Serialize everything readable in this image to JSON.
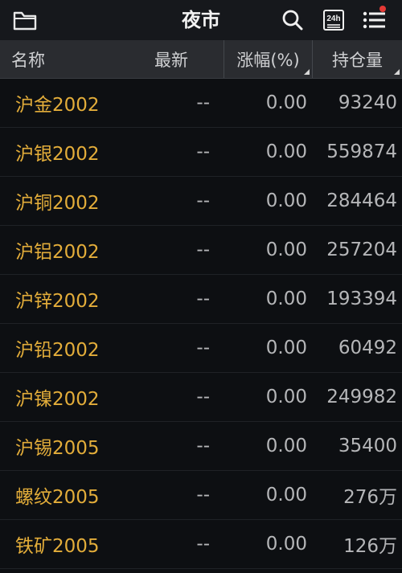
{
  "header": {
    "title": "夜市"
  },
  "icons": {
    "folder": "folder-icon",
    "search": "search-icon",
    "h24": "24h-icon",
    "h24_text": "24h",
    "menu": "menu-list-icon"
  },
  "columns": {
    "name": "名称",
    "latest": "最新",
    "change": "涨幅(%)",
    "open_interest": "持仓量"
  },
  "rows": [
    {
      "name": "沪金2002",
      "latest": "--",
      "change": "0.00",
      "oi": "93240"
    },
    {
      "name": "沪银2002",
      "latest": "--",
      "change": "0.00",
      "oi": "559874"
    },
    {
      "name": "沪铜2002",
      "latest": "--",
      "change": "0.00",
      "oi": "284464"
    },
    {
      "name": "沪铝2002",
      "latest": "--",
      "change": "0.00",
      "oi": "257204"
    },
    {
      "name": "沪锌2002",
      "latest": "--",
      "change": "0.00",
      "oi": "193394"
    },
    {
      "name": "沪铅2002",
      "latest": "--",
      "change": "0.00",
      "oi": "60492"
    },
    {
      "name": "沪镍2002",
      "latest": "--",
      "change": "0.00",
      "oi": "249982"
    },
    {
      "name": "沪锡2005",
      "latest": "--",
      "change": "0.00",
      "oi": "35400"
    },
    {
      "name": "螺纹2005",
      "latest": "--",
      "change": "0.00",
      "oi": "276万"
    },
    {
      "name": "铁矿2005",
      "latest": "--",
      "change": "0.00",
      "oi": "126万"
    }
  ],
  "colors": {
    "name_text": "#e3ad3a",
    "value_text": "#b5b6b8",
    "background": "#0d0f12",
    "header_bg": "#2a2c30",
    "badge": "#e53935"
  }
}
